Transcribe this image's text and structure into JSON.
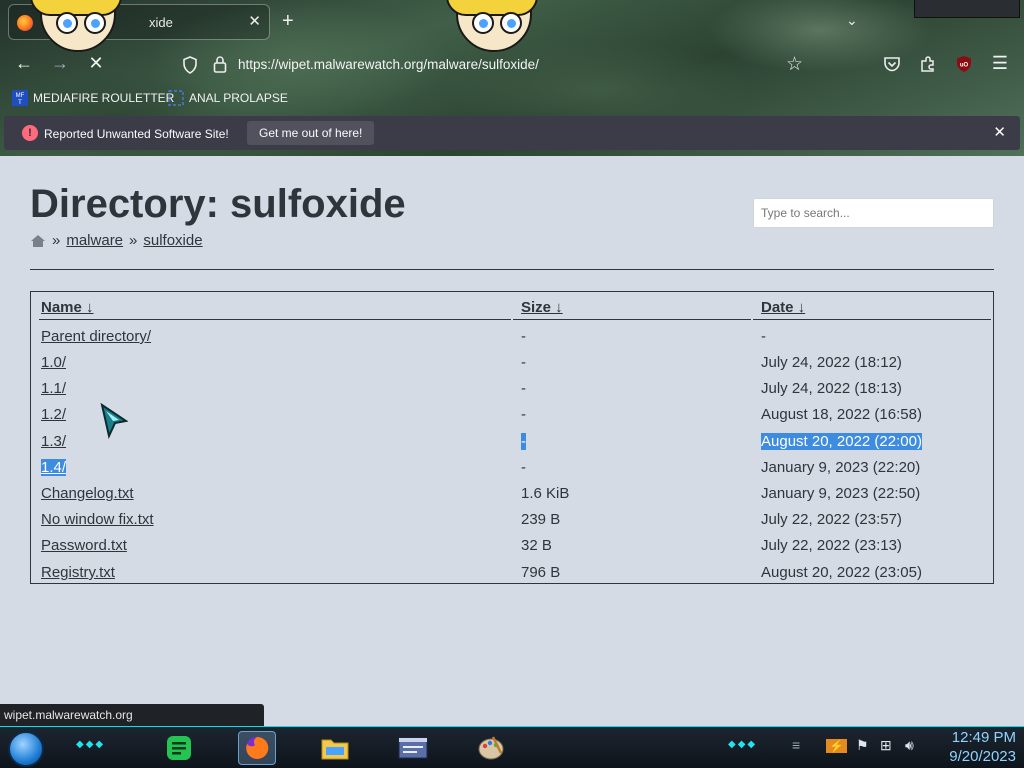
{
  "browser": {
    "tab": {
      "title": "xide"
    },
    "url": "https://wipet.malwarewatch.org/malware/sulfoxide/",
    "bookmarks": [
      {
        "label": "MEDIAFIRE ROULETTER"
      },
      {
        "label": "ANAL PROLAPSE"
      }
    ],
    "notification": {
      "message": "Reported Unwanted Software Site!",
      "button_label": "Get me out of here!"
    },
    "status_url": "wipet.malwarewatch.org"
  },
  "page": {
    "title": "Directory: sulfoxide",
    "search_placeholder": "Type to search...",
    "breadcrumb": {
      "separator": "»",
      "items": [
        "malware",
        "sulfoxide"
      ]
    },
    "columns": {
      "name": "Name  ↓",
      "size": "Size  ↓",
      "date": "Date  ↓"
    },
    "rows": [
      {
        "name": "Parent directory/",
        "size": "-",
        "date": "-"
      },
      {
        "name": "1.0/",
        "size": "-",
        "date": "July 24, 2022 (18:12)"
      },
      {
        "name": "1.1/",
        "size": "-",
        "date": "July 24, 2022 (18:13)"
      },
      {
        "name": "1.2/",
        "size": "-",
        "date": "August 18, 2022 (16:58)"
      },
      {
        "name": "1.3/",
        "size": "-",
        "date": "August 20, 2022 (22:00)"
      },
      {
        "name": "1.4/",
        "size": "-",
        "date": "January 9, 2023 (22:20)"
      },
      {
        "name": "Changelog.txt",
        "size": "1.6 KiB",
        "date": "January 9, 2023 (22:50)"
      },
      {
        "name": "No window fix.txt",
        "size": "239 B",
        "date": "July 22, 2022 (23:57)"
      },
      {
        "name": "Password.txt",
        "size": "32 B",
        "date": "July 22, 2022 (23:13)"
      },
      {
        "name": "Registry.txt",
        "size": "796 B",
        "date": "August 20, 2022 (23:05)"
      }
    ]
  },
  "taskbar": {
    "time": "12:49 PM",
    "date": "9/20/2023"
  },
  "colors": {
    "page_bg": "#d4dbe4",
    "text": "#30353b",
    "selection": "#3d8ce0",
    "notification_bg": "#3c3b48",
    "clock": "#8fd4ff"
  }
}
